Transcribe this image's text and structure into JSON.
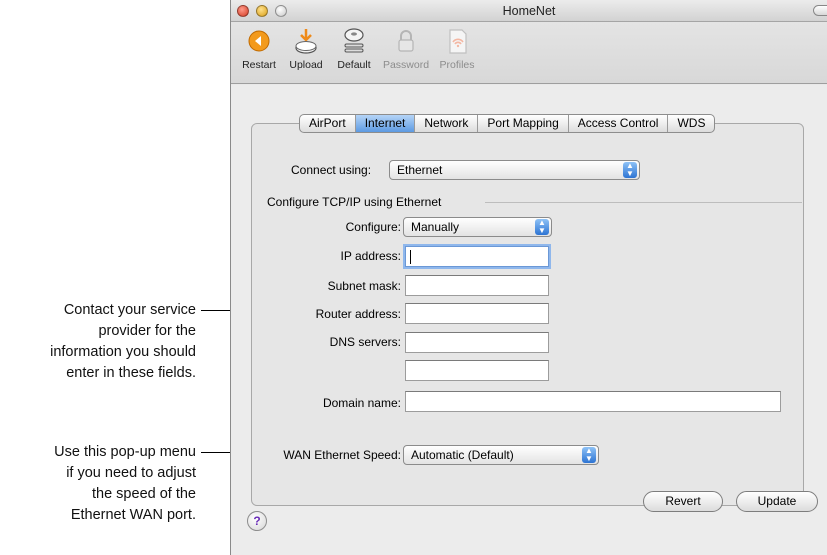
{
  "callouts": {
    "first": [
      "Contact your service",
      "provider for the",
      "information you should",
      "enter in these fields."
    ],
    "second": [
      "Use this pop-up menu",
      "if you need to adjust",
      "the speed of the",
      "Ethernet WAN port."
    ]
  },
  "window": {
    "title": "HomeNet"
  },
  "toolbar": {
    "items": [
      {
        "label": "Restart",
        "icon": "restart-icon",
        "enabled": true
      },
      {
        "label": "Upload",
        "icon": "upload-icon",
        "enabled": true
      },
      {
        "label": "Default",
        "icon": "default-icon",
        "enabled": true
      },
      {
        "label": "Password",
        "icon": "lock-icon",
        "enabled": false
      },
      {
        "label": "Profiles",
        "icon": "profiles-icon",
        "enabled": false
      }
    ]
  },
  "tabs": [
    "AirPort",
    "Internet",
    "Network",
    "Port Mapping",
    "Access Control",
    "WDS"
  ],
  "active_tab": "Internet",
  "form": {
    "connect_using_label": "Connect using:",
    "connect_using_value": "Ethernet",
    "group_title": "Configure TCP/IP using Ethernet",
    "configure_label": "Configure:",
    "configure_value": "Manually",
    "ip_label": "IP address:",
    "ip_value": "",
    "subnet_label": "Subnet mask:",
    "subnet_value": "",
    "router_label": "Router address:",
    "router_value": "",
    "dns_label": "DNS servers:",
    "dns1_value": "",
    "dns2_value": "",
    "domain_label": "Domain name:",
    "domain_value": "",
    "wan_label": "WAN Ethernet Speed:",
    "wan_value": "Automatic (Default)"
  },
  "buttons": {
    "help": "?",
    "revert": "Revert",
    "update": "Update"
  },
  "colors": {
    "accent": "#5d9ae2",
    "restart_orange": "#f39a1c",
    "upload_arrow": "#ee8a1a"
  }
}
